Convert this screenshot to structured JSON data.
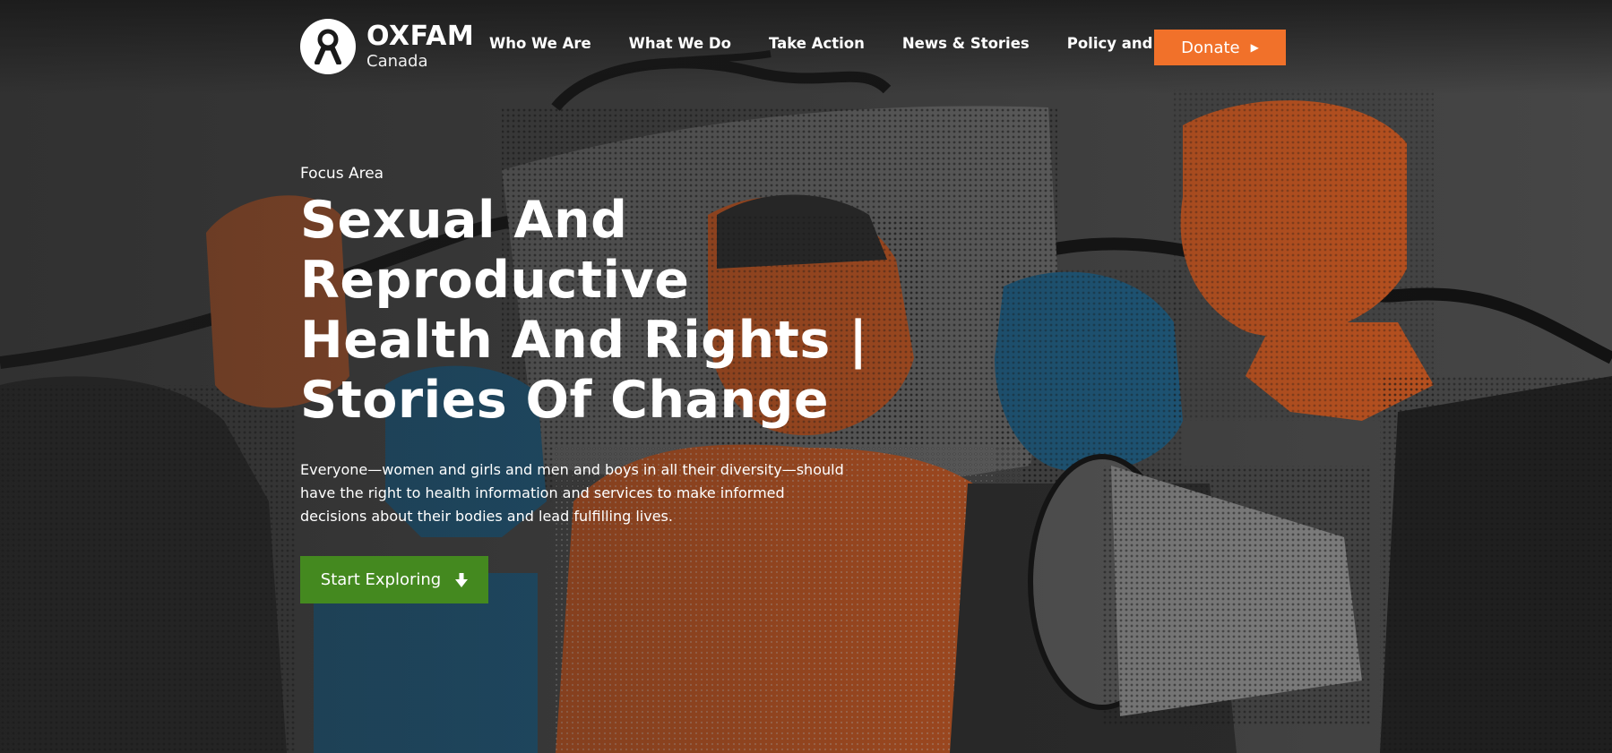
{
  "header": {
    "logo": {
      "name": "OXFAM",
      "country": "Canada"
    },
    "nav": [
      {
        "label": "Who We Are"
      },
      {
        "label": "What We Do"
      },
      {
        "label": "Take Action"
      },
      {
        "label": "News & Stories"
      },
      {
        "label": "Policy and Practice"
      }
    ],
    "donate_label": "Donate",
    "donate_icon": "play-triangle-icon"
  },
  "hero": {
    "eyebrow": "Focus Area",
    "title": "Sexual And Reproductive Health And Rights | Stories Of Change",
    "description": "Everyone—women and girls and men and boys in all their diversity—should have the right to health information and services to make informed decisions about their bodies and lead fulfilling lives.",
    "cta_label": "Start Exploring",
    "cta_icon": "arrow-down-icon"
  },
  "colors": {
    "donate": "#f1712a",
    "cta": "#44891f",
    "accent_orange": "#c8561f",
    "accent_blue": "#1d5f86"
  }
}
